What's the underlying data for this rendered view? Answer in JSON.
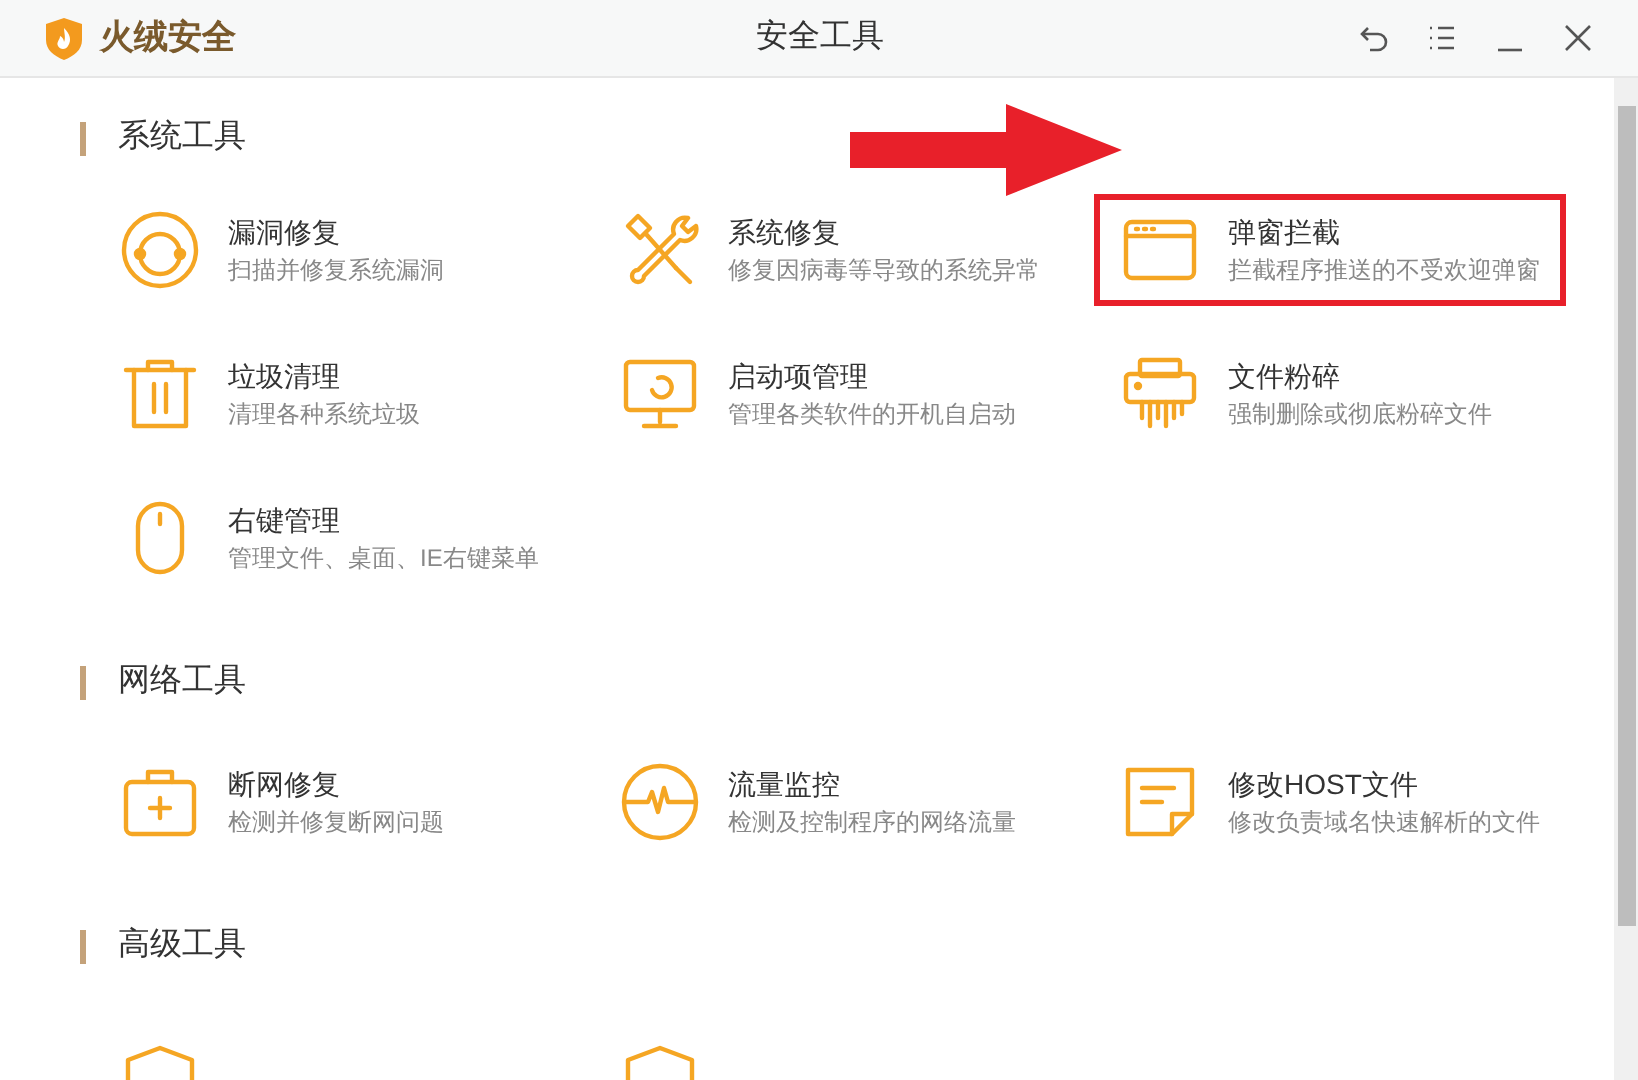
{
  "window": {
    "brand": "火绒安全",
    "title": "安全工具"
  },
  "sections": [
    {
      "title": "系统工具",
      "items": [
        {
          "name": "漏洞修复",
          "desc": "扫描并修复系统漏洞",
          "highlighted": false
        },
        {
          "name": "系统修复",
          "desc": "修复因病毒等导致的系统异常",
          "highlighted": false
        },
        {
          "name": "弹窗拦截",
          "desc": "拦截程序推送的不受欢迎弹窗",
          "highlighted": true
        },
        {
          "name": "垃圾清理",
          "desc": "清理各种系统垃圾",
          "highlighted": false
        },
        {
          "name": "启动项管理",
          "desc": "管理各类软件的开机自启动",
          "highlighted": false
        },
        {
          "name": "文件粉碎",
          "desc": "强制删除或彻底粉碎文件",
          "highlighted": false
        },
        {
          "name": "右键管理",
          "desc": "管理文件、桌面、IE右键菜单",
          "highlighted": false
        }
      ]
    },
    {
      "title": "网络工具",
      "items": [
        {
          "name": "断网修复",
          "desc": "检测并修复断网问题",
          "highlighted": false
        },
        {
          "name": "流量监控",
          "desc": "检测及控制程序的网络流量",
          "highlighted": false
        },
        {
          "name": "修改HOST文件",
          "desc": "修改负责域名快速解析的文件",
          "highlighted": false
        }
      ]
    },
    {
      "title": "高级工具"
    }
  ]
}
